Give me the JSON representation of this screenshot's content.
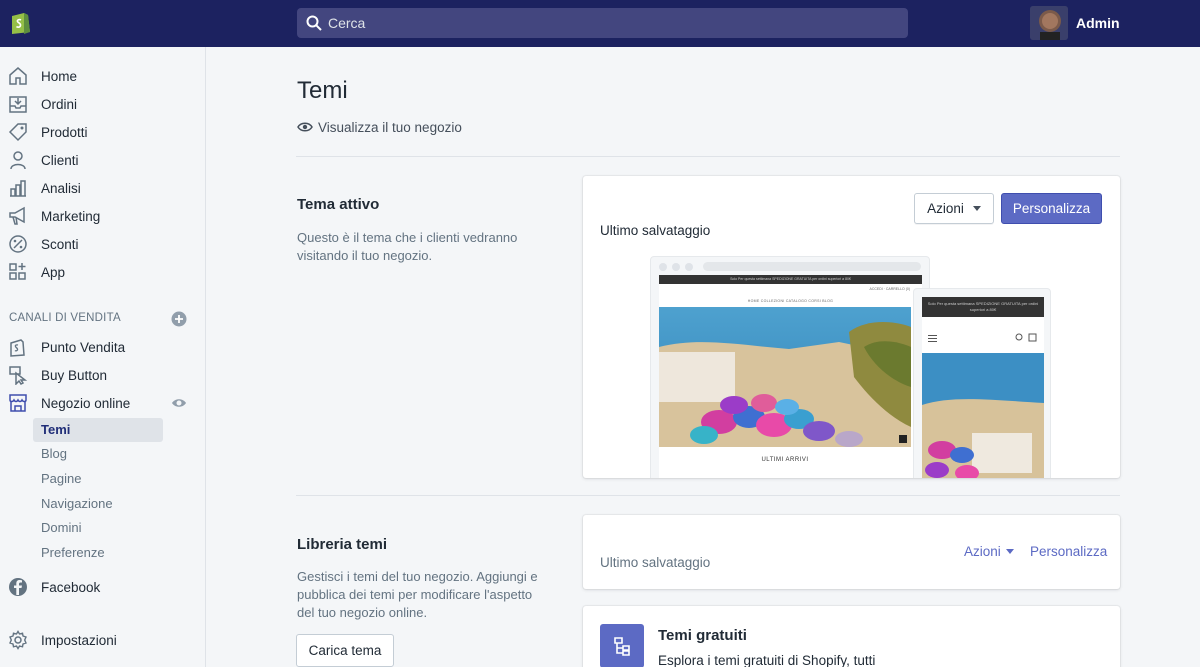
{
  "topbar": {
    "search_placeholder": "Cerca",
    "user_name": "Admin"
  },
  "sidebar": {
    "items": [
      {
        "label": "Home",
        "icon": "home-icon"
      },
      {
        "label": "Ordini",
        "icon": "orders-icon"
      },
      {
        "label": "Prodotti",
        "icon": "tag-icon"
      },
      {
        "label": "Clienti",
        "icon": "customer-icon"
      },
      {
        "label": "Analisi",
        "icon": "analytics-icon"
      },
      {
        "label": "Marketing",
        "icon": "megaphone-icon"
      },
      {
        "label": "Sconti",
        "icon": "discount-icon"
      },
      {
        "label": "App",
        "icon": "apps-icon"
      }
    ],
    "channels_title": "CANALI DI VENDITA",
    "channels": [
      {
        "label": "Punto Vendita",
        "icon": "pos-icon"
      },
      {
        "label": "Buy Button",
        "icon": "buy-button-icon"
      },
      {
        "label": "Negozio online",
        "icon": "store-icon"
      }
    ],
    "store_subitems": [
      "Temi",
      "Blog",
      "Pagine",
      "Navigazione",
      "Domini",
      "Preferenze"
    ],
    "facebook": "Facebook",
    "settings": "Impostazioni"
  },
  "main": {
    "title": "Temi",
    "view_store": "Visualizza il tuo negozio",
    "active_theme": {
      "heading": "Tema attivo",
      "description": "Questo è il tema che i clienti vedranno visitando il tuo negozio.",
      "last_saved": "Ultimo salvataggio",
      "actions_label": "Azioni",
      "customize_label": "Personalizza",
      "preview": {
        "announcement": "Solo Per questa settimana SPEDIZIONE GRATUITA per ordini superiori a 80€",
        "account_links": "ACCEDI · CARRELLO (0)",
        "menu": "HOME   COLLEZIONI   CATALOGO   CORSI   BLOG",
        "section_label": "ULTIMI ARRIVI",
        "mobile_announcement": "Solo Per questa settimana SPEDIZIONE GRATUITA per ordini superiori a 80€"
      }
    },
    "library": {
      "heading": "Libreria temi",
      "description": "Gestisci i temi del tuo negozio. Aggiungi e pubblica dei temi per modificare l'aspetto del tuo negozio online.",
      "upload_label": "Carica tema",
      "last_saved": "Ultimo salvataggio",
      "actions_label": "Azioni",
      "customize_label": "Personalizza"
    },
    "free_themes": {
      "title": "Temi gratuiti",
      "description": "Esplora i temi gratuiti di Shopify, tutti"
    }
  },
  "colors": {
    "topbar": "#1c2260",
    "primary": "#5c6ac4",
    "sidebar_bg": "#f4f6f8"
  }
}
